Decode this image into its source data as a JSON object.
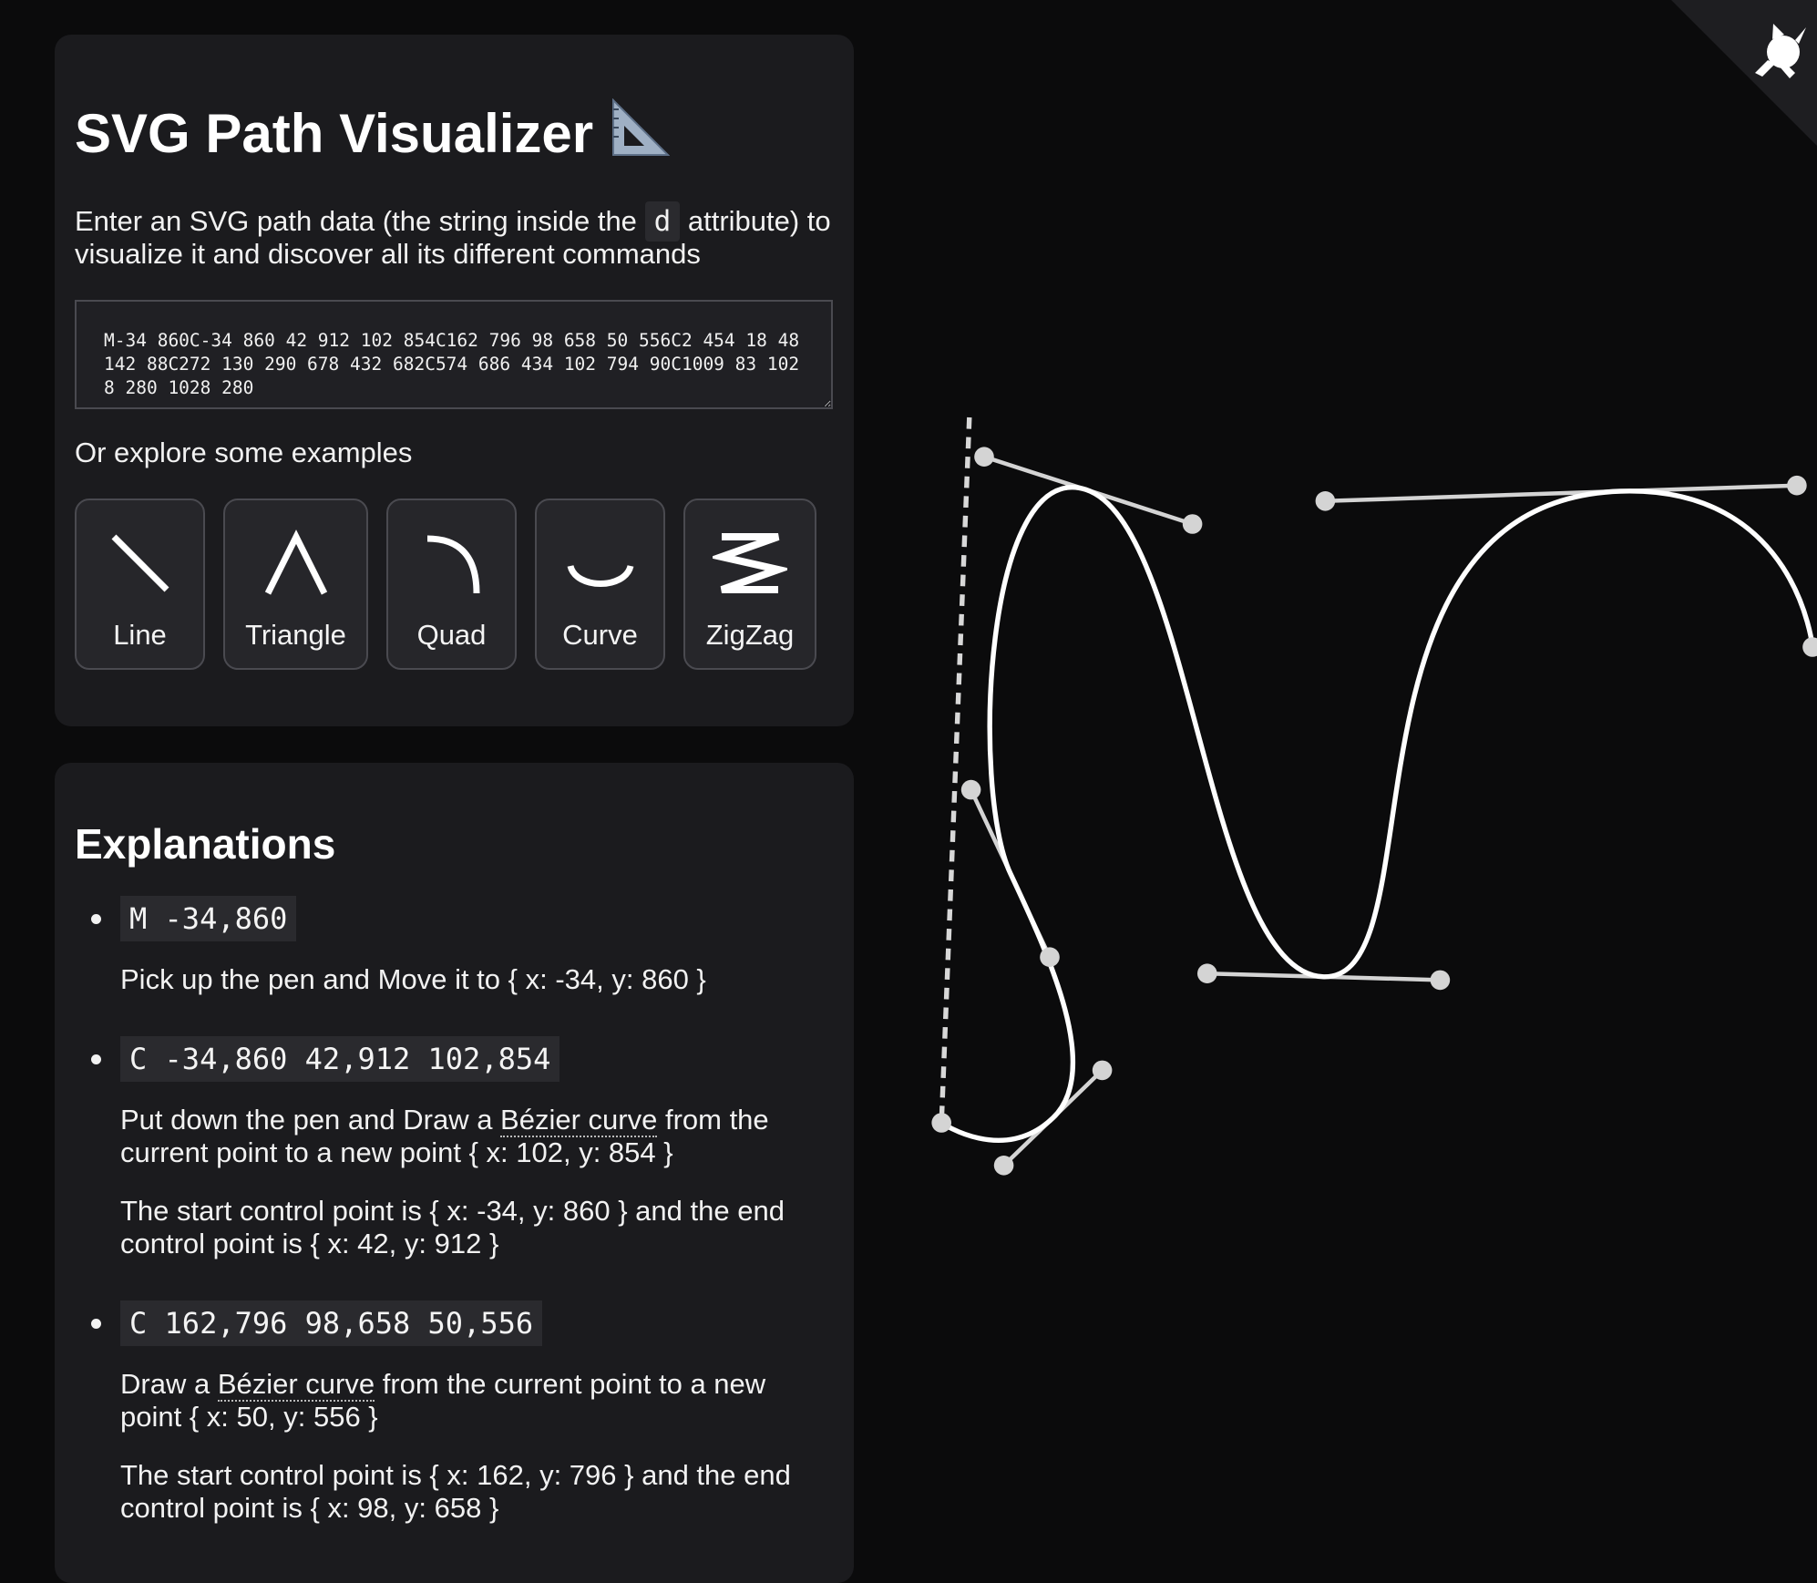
{
  "header": {
    "title": "SVG Path Visualizer",
    "intro_before": "Enter an SVG path data (the string inside the",
    "intro_code": "d",
    "intro_after": "attribute) to visualize it and discover all its different commands"
  },
  "path_input": {
    "value": "M-34 860C-34 860 42 912 102 854C162 796 98 658 50 556C2 454 18 48 142 88C272 130 290 678 432 682C574 686 434 102 794 90C1009 83 1028 280 1028 280"
  },
  "examples": {
    "label": "Or explore some examples",
    "items": [
      {
        "label": "Line",
        "icon": "line-icon"
      },
      {
        "label": "Triangle",
        "icon": "triangle-icon"
      },
      {
        "label": "Quad",
        "icon": "quad-icon"
      },
      {
        "label": "Curve",
        "icon": "curve-icon"
      },
      {
        "label": "ZigZag",
        "icon": "zigzag-icon"
      }
    ]
  },
  "explanations": {
    "title": "Explanations",
    "items": [
      {
        "code": "M -34,860",
        "text1": "Pick up the pen and Move it to { x: -34, y: 860 }"
      },
      {
        "code": "C -34,860 42,912 102,854",
        "text1_before": "Put down the pen and Draw a ",
        "text1_link": "Bézier curve",
        "text1_after": " from the current point to a new point { x: 102, y: 854 }",
        "text2": "The start control point is { x: -34, y: 860 } and the end control point is { x: 42, y: 912 }"
      },
      {
        "code": "C 162,796 98,658 50,556",
        "text1_before": "Draw a ",
        "text1_link": "Bézier curve",
        "text1_after": " from the current point to a new point { x: 50, y: 556 }",
        "text2": "The start control point is { x: 162, y: 796 } and the end control point is { x: 98, y: 658 }"
      }
    ]
  },
  "icons": {
    "title_icon": "triangular-ruler-icon",
    "corner_icon": "github-octocat-icon"
  },
  "colors": {
    "background": "#0b0b0c",
    "card": "#1b1b1e",
    "path_stroke": "#ffffff",
    "handle_fill": "#d4d4d4"
  }
}
